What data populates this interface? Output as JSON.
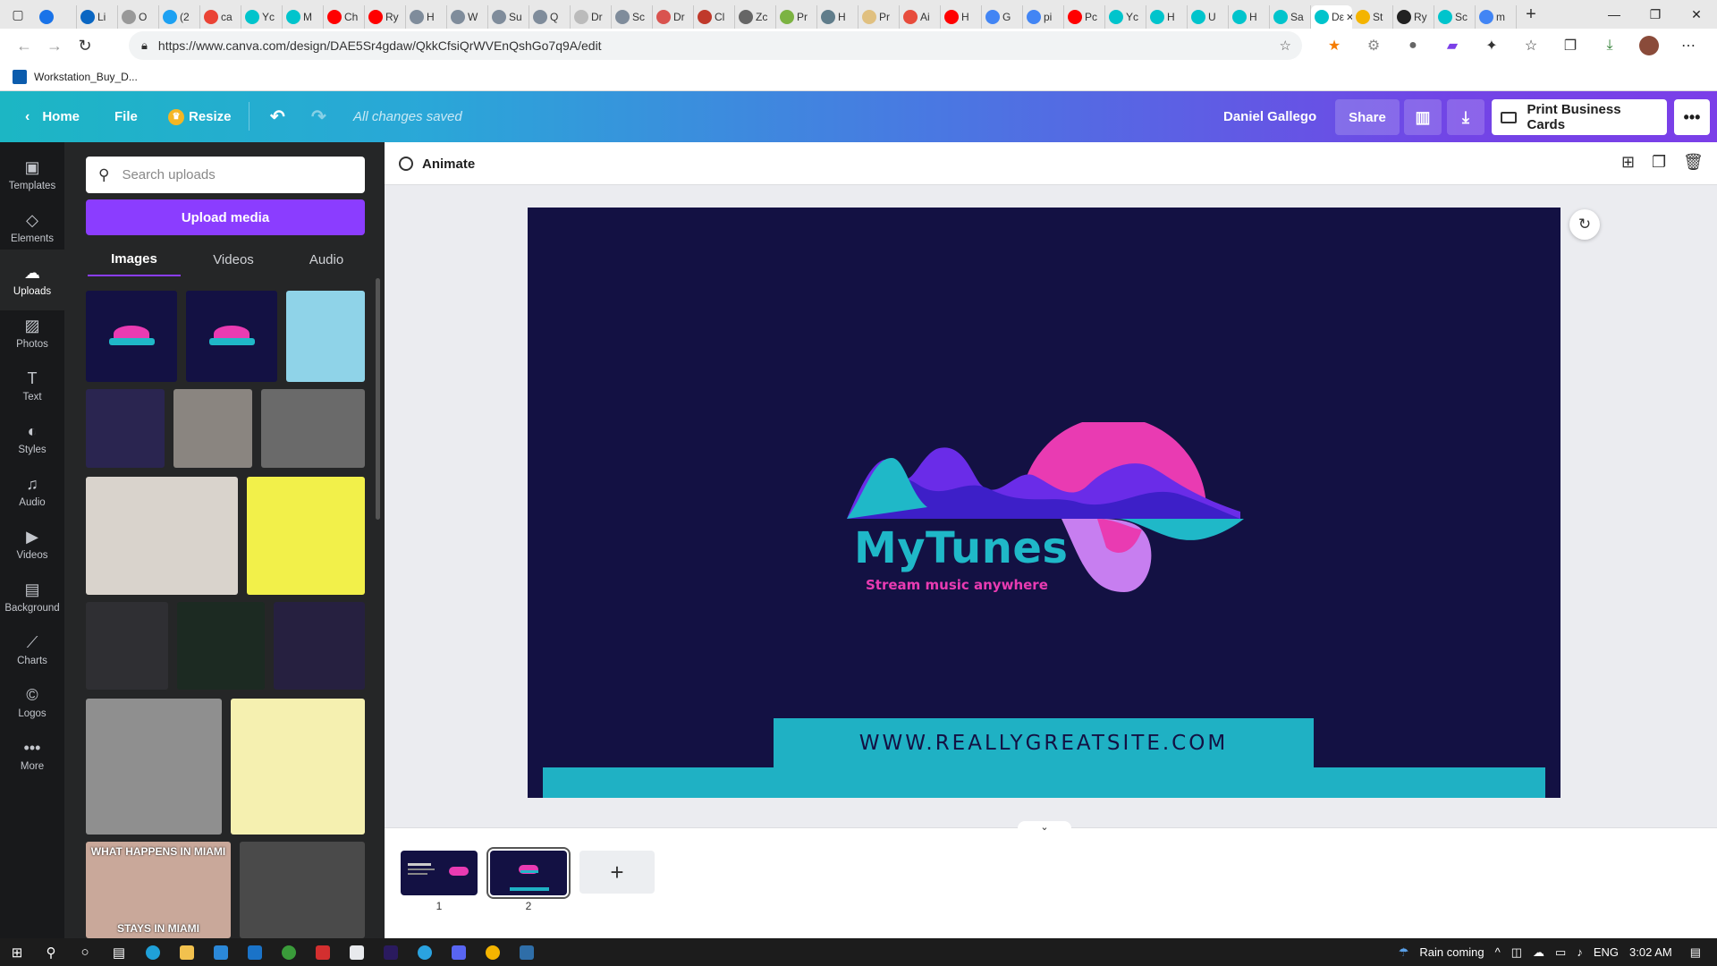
{
  "browser": {
    "tabs": [
      {
        "label": "",
        "color": "#1a73e8"
      },
      {
        "label": "Li",
        "color": "#0a66c2"
      },
      {
        "label": "O",
        "color": "#999999"
      },
      {
        "label": "(2",
        "color": "#1da1f2"
      },
      {
        "label": "ca",
        "color": "#ea4335"
      },
      {
        "label": "Yc",
        "color": "#00c4cc"
      },
      {
        "label": "M",
        "color": "#00c4cc"
      },
      {
        "label": "Ch",
        "color": "#ff0000"
      },
      {
        "label": "Ry",
        "color": "#ff0000"
      },
      {
        "label": "H",
        "color": "#7f8c9b"
      },
      {
        "label": "W",
        "color": "#7f8c9b"
      },
      {
        "label": "Su",
        "color": "#7f8c9b"
      },
      {
        "label": "Q",
        "color": "#7f8c9b"
      },
      {
        "label": "Dr",
        "color": "#bbbbbb"
      },
      {
        "label": "Sc",
        "color": "#7f8c9b"
      },
      {
        "label": "Dr",
        "color": "#d9534f"
      },
      {
        "label": "Cl",
        "color": "#c0392b"
      },
      {
        "label": "Zc",
        "color": "#666666"
      },
      {
        "label": "Pr",
        "color": "#7cb342"
      },
      {
        "label": "H",
        "color": "#607d8b"
      },
      {
        "label": "Pr",
        "color": "#e0c080"
      },
      {
        "label": "Ai",
        "color": "#e74c3c"
      },
      {
        "label": "H",
        "color": "#ff0000"
      },
      {
        "label": "G",
        "color": "#4285f4"
      },
      {
        "label": "pi",
        "color": "#4285f4"
      },
      {
        "label": "Pc",
        "color": "#ff0000"
      },
      {
        "label": "Yc",
        "color": "#00c4cc"
      },
      {
        "label": "H",
        "color": "#00c4cc"
      },
      {
        "label": "U",
        "color": "#00c4cc"
      },
      {
        "label": "H",
        "color": "#00c4cc"
      },
      {
        "label": "Sa",
        "color": "#00c4cc"
      },
      {
        "label": "Dε",
        "color": "#00c4cc",
        "active": true
      },
      {
        "label": "St",
        "color": "#f4b400"
      },
      {
        "label": "Ry",
        "color": "#222222"
      },
      {
        "label": "Sc",
        "color": "#00c4cc"
      },
      {
        "label": "m",
        "color": "#4285f4"
      }
    ],
    "url": "https://www.canva.com/design/DAE5Sr4gdaw/QkkCfsiQrWVEnQshGo7q9A/edit",
    "bookmark": "Workstation_Buy_D..."
  },
  "header": {
    "home": "Home",
    "file": "File",
    "resize": "Resize",
    "saved_status": "All changes saved",
    "user": "Daniel Gallego",
    "share": "Share",
    "print": "Print Business Cards"
  },
  "rail": [
    {
      "label": "Templates",
      "icon": "templates-icon",
      "glyph": "▣"
    },
    {
      "label": "Elements",
      "icon": "elements-icon",
      "glyph": "◇"
    },
    {
      "label": "Uploads",
      "icon": "uploads-icon",
      "glyph": "☁",
      "active": true
    },
    {
      "label": "Photos",
      "icon": "photos-icon",
      "glyph": "▨"
    },
    {
      "label": "Text",
      "icon": "text-icon",
      "glyph": "T"
    },
    {
      "label": "Styles",
      "icon": "styles-icon",
      "glyph": "◐"
    },
    {
      "label": "Audio",
      "icon": "audio-icon",
      "glyph": "♫"
    },
    {
      "label": "Videos",
      "icon": "videos-icon",
      "glyph": "▶"
    },
    {
      "label": "Background",
      "icon": "background-icon",
      "glyph": "▤"
    },
    {
      "label": "Charts",
      "icon": "charts-icon",
      "glyph": "⟋"
    },
    {
      "label": "Logos",
      "icon": "logos-icon",
      "glyph": "©"
    },
    {
      "label": "More",
      "icon": "more-icon",
      "glyph": "•••"
    }
  ],
  "panel": {
    "search_placeholder": "Search uploads",
    "upload_button": "Upload media",
    "tabs": [
      "Images",
      "Videos",
      "Audio"
    ]
  },
  "thumbnails": [
    {
      "desc": "mytunes-logo-thumb",
      "bg": "#131143"
    },
    {
      "desc": "mytunes-logo-thumb",
      "bg": "#131143"
    },
    {
      "desc": "cartoon-character-thumb",
      "bg": "#8fd3e8"
    },
    {
      "desc": "anime-character-thumb",
      "bg": "#2a2550"
    },
    {
      "desc": "woman-photo-thumb",
      "bg": "#8a8580"
    },
    {
      "desc": "man-cards-photo-thumb",
      "bg": "#6a6a6a"
    },
    {
      "desc": "man-holding-drawing-thumb",
      "bg": "#d9d3cc"
    },
    {
      "desc": "pixel-dino-thumb",
      "bg": "#f2f04a"
    },
    {
      "desc": "cap-thumb",
      "bg": "#2f2f33"
    },
    {
      "desc": "isometric-island-thumb",
      "bg": "#1c2a22"
    },
    {
      "desc": "isometric-room-thumb",
      "bg": "#262040"
    },
    {
      "desc": "ape-nft-thumb",
      "bg": "#8f8f8f"
    },
    {
      "desc": "golden-ape-thumb",
      "bg": "#f5f0b0"
    },
    {
      "desc": "meme-doll-thumb",
      "bg": "#c9a89a",
      "top": "WHAT HAPPENS IN MIAMI",
      "bottom": "STAYS IN MIAMI"
    },
    {
      "desc": "meme-man-thumb",
      "bg": "#4a4a4a"
    }
  ],
  "toolbar": {
    "animate": "Animate"
  },
  "design": {
    "brand": "MyTunes",
    "tagline": "Stream music anywhere",
    "website": "WWW.REALLYGREATSITE.COM",
    "colors": {
      "background": "#131143",
      "accent": "#1fb1c4",
      "pink": "#e93bb2"
    }
  },
  "pages": [
    {
      "number": "1"
    },
    {
      "number": "2",
      "active": true
    }
  ],
  "taskbar": {
    "weather": "Rain coming",
    "language": "ENG",
    "time": "3:02 AM"
  }
}
